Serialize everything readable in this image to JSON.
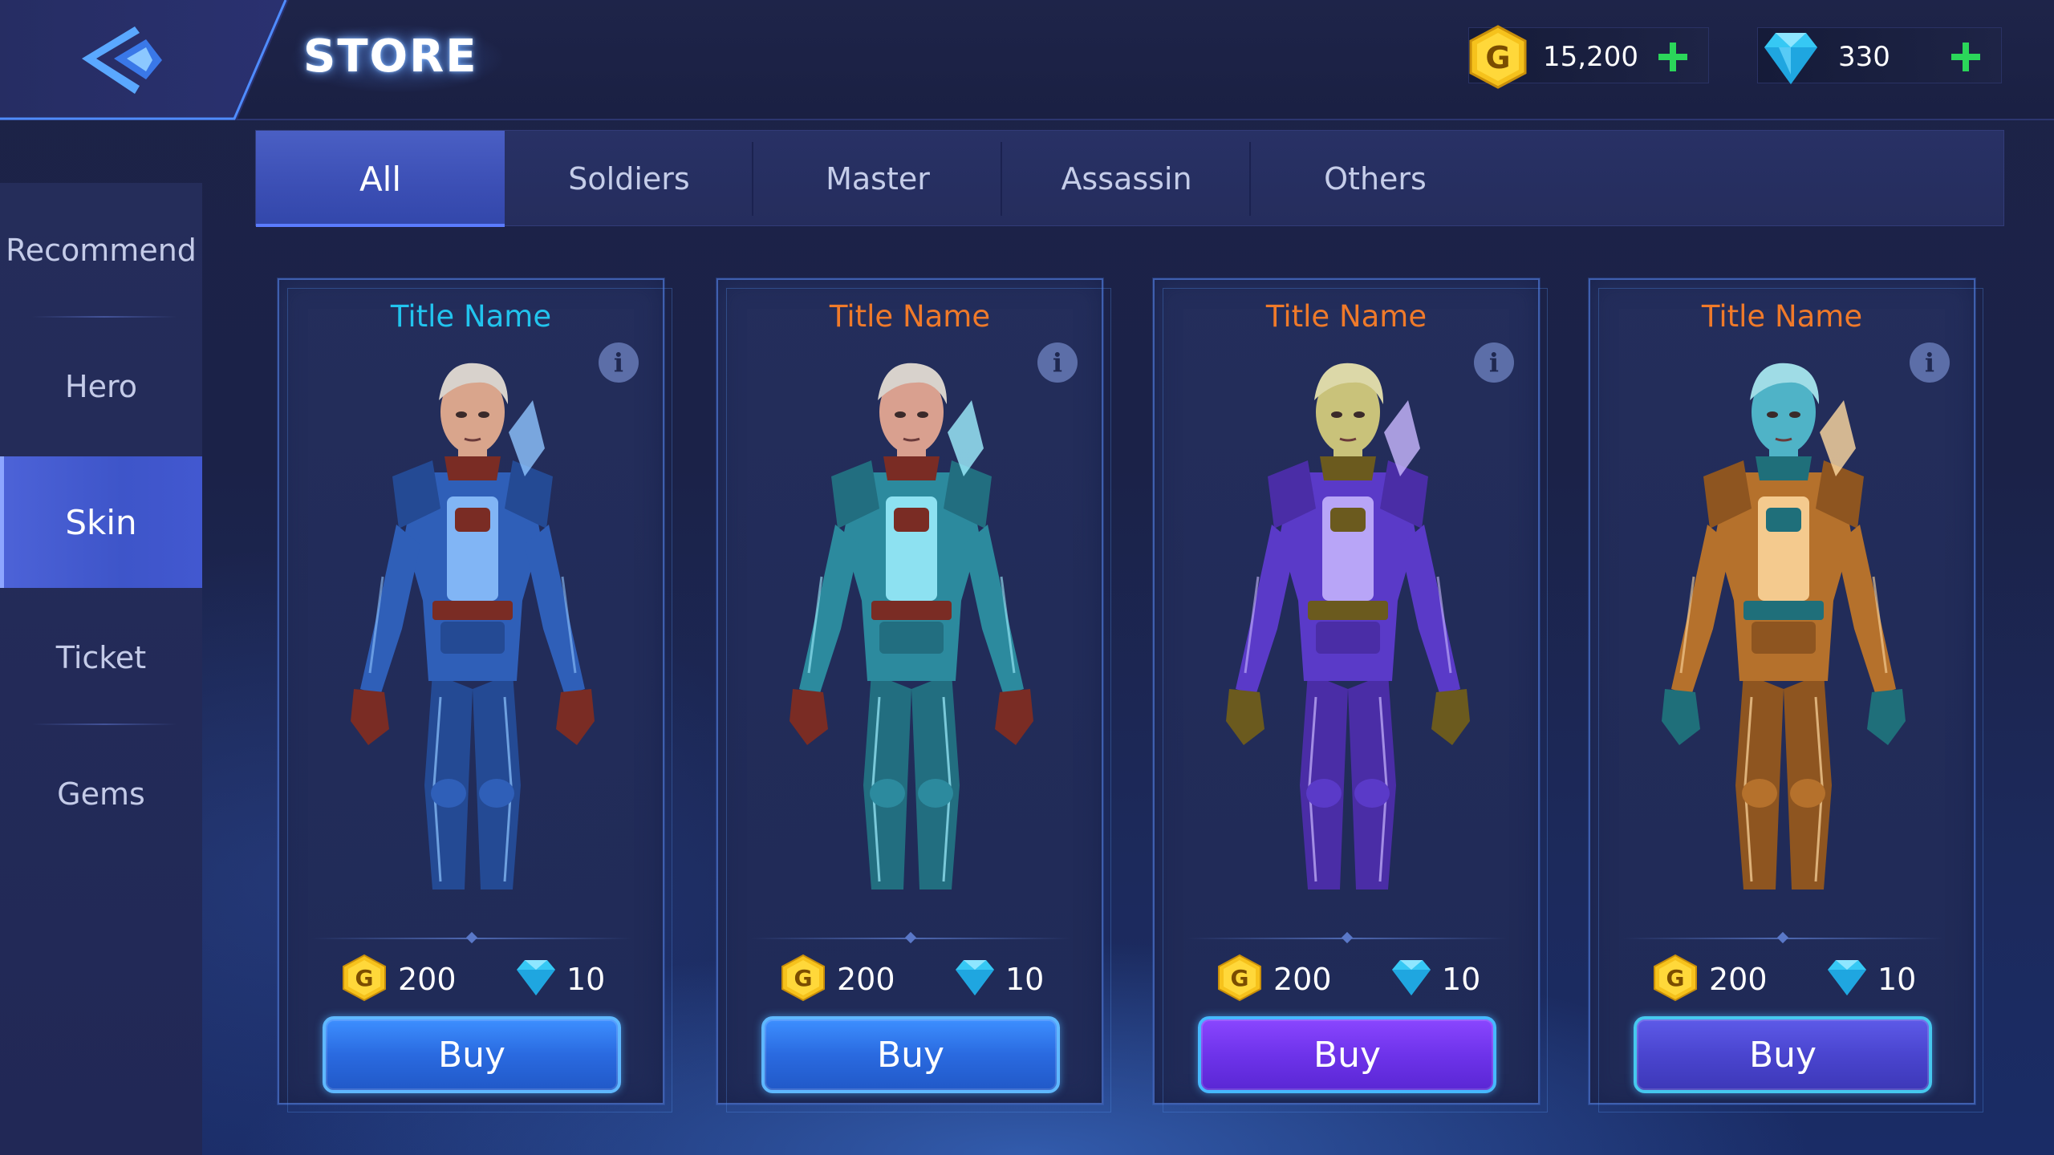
{
  "header": {
    "title": "STORE",
    "back_icon": "back-chevron-icon"
  },
  "currency": {
    "gold": {
      "value": "15,200",
      "icon": "gold-coin-icon",
      "letter": "G"
    },
    "gems": {
      "value": "330",
      "icon": "diamond-icon"
    }
  },
  "tabs": [
    {
      "label": "All",
      "active": true
    },
    {
      "label": "Soldiers",
      "active": false
    },
    {
      "label": "Master",
      "active": false
    },
    {
      "label": "Assassin",
      "active": false
    },
    {
      "label": "Others",
      "active": false
    }
  ],
  "sidebar": {
    "items": [
      {
        "label": "Recommend",
        "active": false
      },
      {
        "label": "Hero",
        "active": false
      },
      {
        "label": "Skin",
        "active": true
      },
      {
        "label": "Ticket",
        "active": false
      },
      {
        "label": "Gems",
        "active": false
      }
    ]
  },
  "products": [
    {
      "title": "Title Name",
      "title_color": "#22c4ee",
      "gold_price": "200",
      "gem_price": "10",
      "buy_label": "Buy",
      "skin": "blue",
      "button_style": "blue"
    },
    {
      "title": "Title Name",
      "title_color": "#f07a2a",
      "gold_price": "200",
      "gem_price": "10",
      "buy_label": "Buy",
      "skin": "teal",
      "button_style": "blue"
    },
    {
      "title": "Title Name",
      "title_color": "#f07a2a",
      "gold_price": "200",
      "gem_price": "10",
      "buy_label": "Buy",
      "skin": "purple",
      "button_style": "purple"
    },
    {
      "title": "Title Name",
      "title_color": "#f07a2a",
      "gold_price": "200",
      "gem_price": "10",
      "buy_label": "Buy",
      "skin": "orange",
      "button_style": "indigo"
    }
  ],
  "colors": {
    "accent": "#4a5fc4",
    "plus": "#2bd65a",
    "gold": "#f5c518",
    "gem": "#36c8f4"
  }
}
